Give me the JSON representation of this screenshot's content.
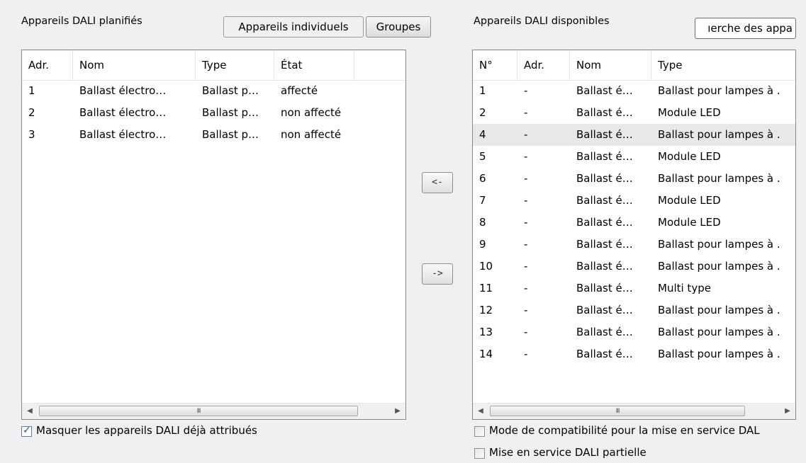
{
  "left_panel": {
    "title": "Appareils DALI planifiés",
    "tabs": [
      {
        "label": "Appareils individuels",
        "active": true
      },
      {
        "label": "Groupes",
        "active": false
      }
    ],
    "columns": [
      "Adr.",
      "Nom",
      "Type",
      "État"
    ],
    "rows": [
      {
        "adr": "1",
        "nom": "Ballast électro…",
        "type": "Ballast p…",
        "etat": "affecté"
      },
      {
        "adr": "2",
        "nom": "Ballast électro…",
        "type": "Ballast p…",
        "etat": "non affecté"
      },
      {
        "adr": "3",
        "nom": "Ballast électro…",
        "type": "Ballast p…",
        "etat": "non affecté"
      }
    ],
    "hide_assigned": {
      "label": "Masquer les appareils DALI déjà attribués",
      "checked": true
    }
  },
  "transfer": {
    "to_left_label": "<-",
    "to_right_label": "->"
  },
  "right_panel": {
    "title": "Appareils DALI disponibles",
    "search_button_label": "ıerche des appa",
    "columns": [
      "N°",
      "Adr.",
      "Nom",
      "Type"
    ],
    "rows": [
      {
        "no": "1",
        "adr": "-",
        "nom": "Ballast é…",
        "type": "Ballast pour lampes à ."
      },
      {
        "no": "2",
        "adr": "-",
        "nom": "Ballast é…",
        "type": "Module LED"
      },
      {
        "no": "4",
        "adr": "-",
        "nom": "Ballast é…",
        "type": "Ballast pour lampes à .",
        "selected": true
      },
      {
        "no": "5",
        "adr": "-",
        "nom": "Ballast é…",
        "type": "Module LED"
      },
      {
        "no": "6",
        "adr": "-",
        "nom": "Ballast é…",
        "type": "Ballast pour lampes à ."
      },
      {
        "no": "7",
        "adr": "-",
        "nom": "Ballast é…",
        "type": "Module LED"
      },
      {
        "no": "8",
        "adr": "-",
        "nom": "Ballast é…",
        "type": "Module LED"
      },
      {
        "no": "9",
        "adr": "-",
        "nom": "Ballast é…",
        "type": "Ballast pour lampes à ."
      },
      {
        "no": "10",
        "adr": "-",
        "nom": "Ballast é…",
        "type": "Ballast pour lampes à ."
      },
      {
        "no": "11",
        "adr": "-",
        "nom": "Ballast é…",
        "type": "Multi type"
      },
      {
        "no": "12",
        "adr": "-",
        "nom": "Ballast é…",
        "type": "Ballast pour lampes à ."
      },
      {
        "no": "13",
        "adr": "-",
        "nom": "Ballast é…",
        "type": "Ballast pour lampes à ."
      },
      {
        "no": "14",
        "adr": "-",
        "nom": "Ballast é…",
        "type": "Ballast pour lampes à ."
      }
    ],
    "compat_mode": {
      "label": "Mode de compatibilité pour la mise en service DAL",
      "checked": false
    },
    "partial_commissioning": {
      "label": "Mise en service DALI partielle",
      "checked": false
    }
  },
  "scrollbar": {
    "left_icon": "scroll-left-arrow-icon",
    "right_icon": "scroll-right-arrow-icon",
    "grip_icon": "scroll-grip-icon",
    "grip_glyph": "III"
  },
  "colors": {
    "selected_row": "#e8e8e8",
    "border": "#828790",
    "background": "#f0f0f0"
  }
}
